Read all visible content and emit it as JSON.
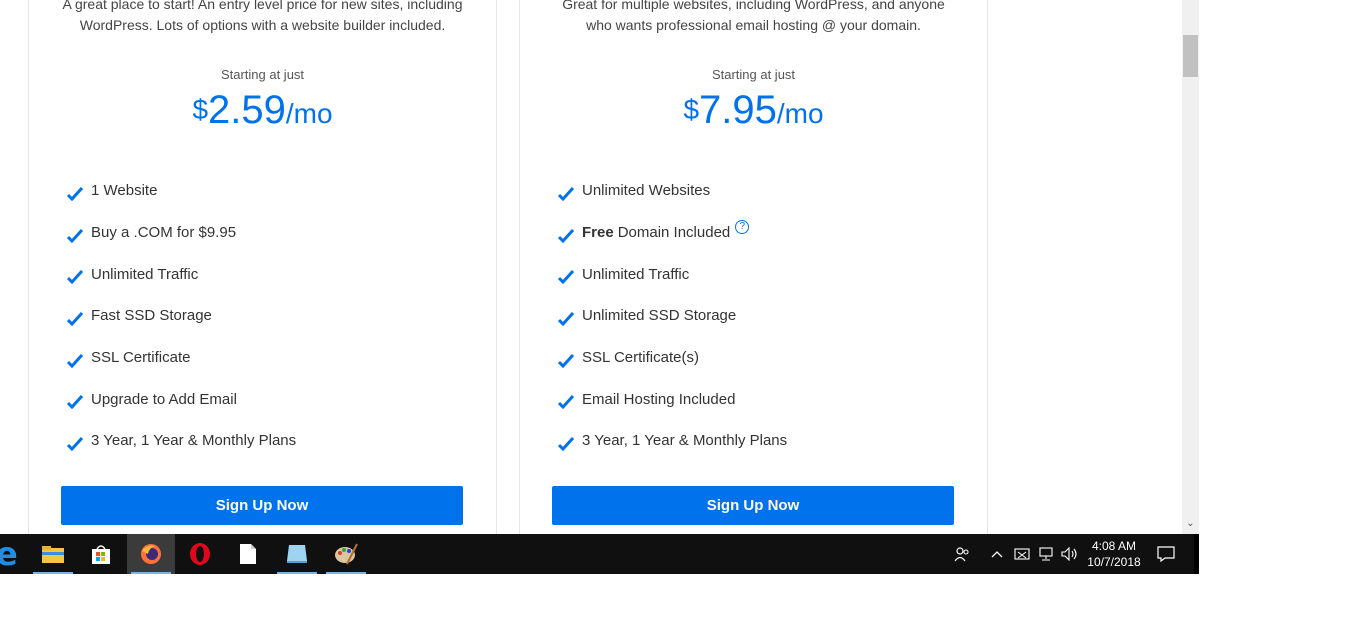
{
  "plans": [
    {
      "description": "A great place to start! An entry level price for new sites, including\nWordPress. Lots of options with a website builder included.",
      "starting_label": "Starting at just",
      "price": {
        "currency": "$",
        "amount": "2.59",
        "period": "/mo"
      },
      "features": [
        {
          "bold": "",
          "text": "1 Website",
          "help": ""
        },
        {
          "bold": "",
          "text": "Buy a .COM for $9.95",
          "help": ""
        },
        {
          "bold": "",
          "text": "Unlimited Traffic",
          "help": ""
        },
        {
          "bold": "",
          "text": "Fast SSD Storage",
          "help": ""
        },
        {
          "bold": "",
          "text": "SSL Certificate",
          "help": ""
        },
        {
          "bold": "",
          "text": "Upgrade to Add Email",
          "help": ""
        },
        {
          "bold": "",
          "text": "3 Year, 1 Year & Monthly Plans",
          "help": ""
        }
      ],
      "button": "Sign Up Now"
    },
    {
      "description": "Great for multiple websites, including WordPress, and anyone\nwho wants professional email hosting @ your domain.",
      "starting_label": "Starting at just",
      "price": {
        "currency": "$",
        "amount": "7.95",
        "period": "/mo"
      },
      "features": [
        {
          "bold": "",
          "text": "Unlimited Websites",
          "help": ""
        },
        {
          "bold": "Free",
          "text": "Domain Included",
          "help": "?"
        },
        {
          "bold": "",
          "text": "Unlimited Traffic",
          "help": ""
        },
        {
          "bold": "",
          "text": "Unlimited SSD Storage",
          "help": ""
        },
        {
          "bold": "",
          "text": "SSL Certificate(s)",
          "help": ""
        },
        {
          "bold": "",
          "text": "Email Hosting Included",
          "help": ""
        },
        {
          "bold": "",
          "text": "3 Year, 1 Year & Monthly Plans",
          "help": ""
        }
      ],
      "button": "Sign Up Now"
    }
  ],
  "colors": {
    "accent": "#0073ec",
    "taskbar": "#101010"
  },
  "taskbar": {
    "edge_glyph": "e",
    "apps": [
      "file-explorer-icon",
      "store-icon",
      "firefox-icon",
      "opera-icon",
      "notepad-icon",
      "app-icon",
      "paint-icon"
    ],
    "clock": {
      "time": "4:08 AM",
      "date": "10/7/2018"
    }
  }
}
